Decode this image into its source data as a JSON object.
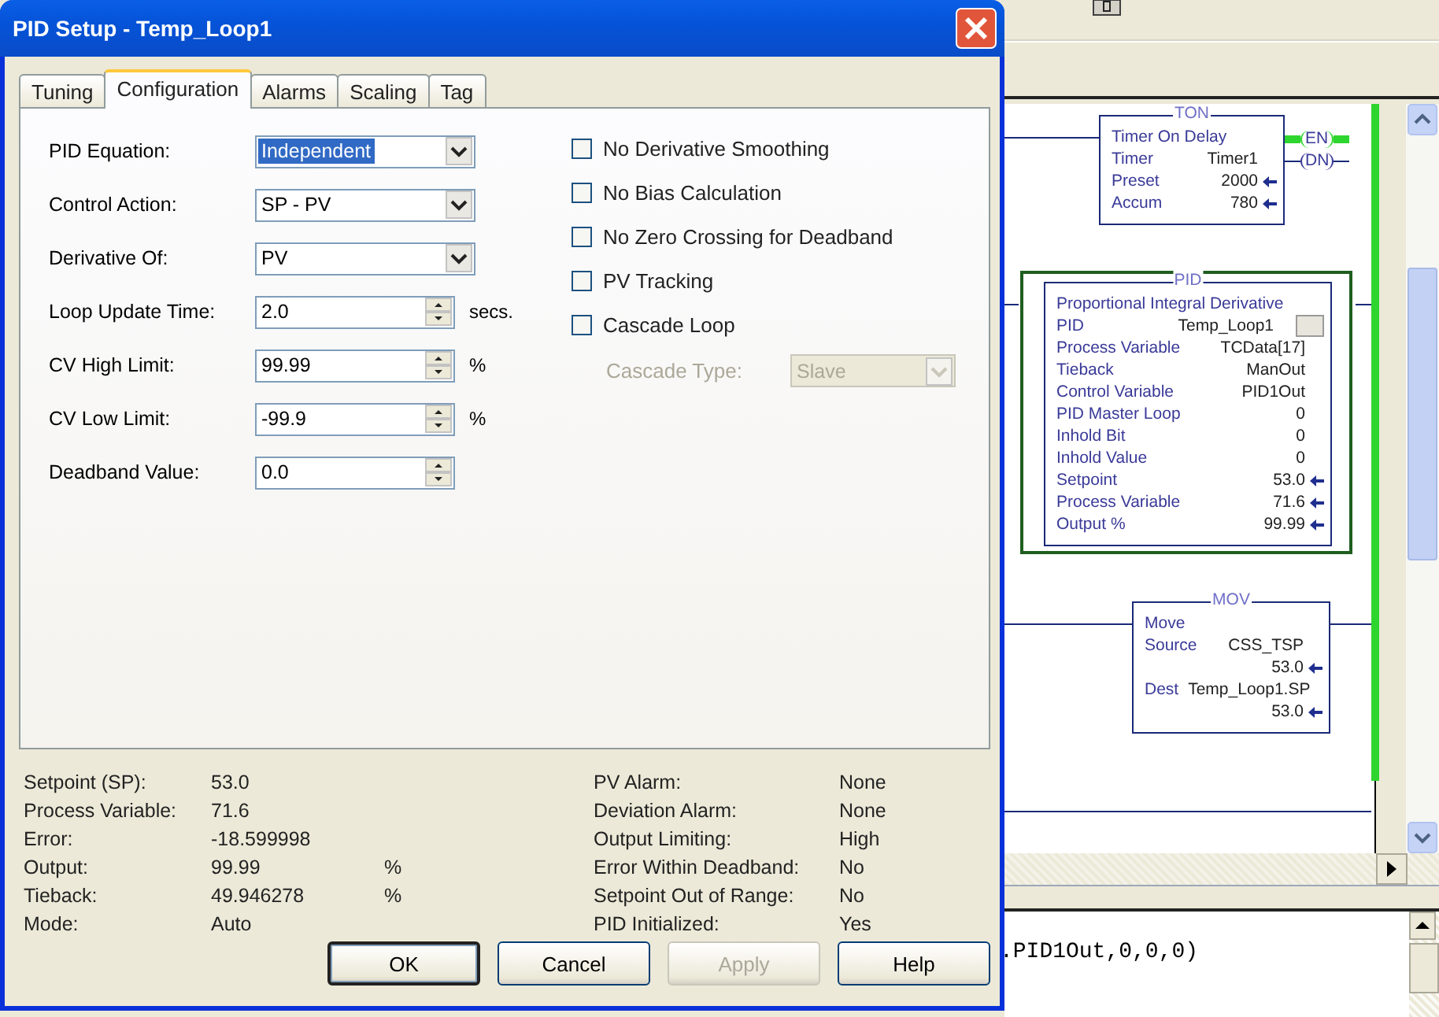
{
  "dialog": {
    "title": "PID Setup - Temp_Loop1",
    "tabs": [
      {
        "label": "Tuning",
        "selected": false
      },
      {
        "label": "Configuration",
        "selected": true
      },
      {
        "label": "Alarms",
        "selected": false
      },
      {
        "label": "Scaling",
        "selected": false
      },
      {
        "label": "Tag",
        "selected": false
      }
    ],
    "fields": [
      {
        "kind": "combo",
        "label": "PID Equation:",
        "value": "Independent",
        "highlighted": true
      },
      {
        "kind": "combo",
        "label": "Control Action:",
        "value": "SP - PV",
        "highlighted": false
      },
      {
        "kind": "combo",
        "label": "Derivative Of:",
        "value": "PV",
        "highlighted": false
      },
      {
        "kind": "spin",
        "label": "Loop Update Time:",
        "value": "2.0",
        "unit": "secs."
      },
      {
        "kind": "spin",
        "label": "CV High Limit:",
        "value": "99.99",
        "unit": "%"
      },
      {
        "kind": "spin",
        "label": "CV Low Limit:",
        "value": "-99.9",
        "unit": "%"
      },
      {
        "kind": "spin",
        "label": "Deadband Value:",
        "value": "0.0"
      }
    ],
    "options": [
      {
        "label": "No Derivative Smoothing",
        "checked": false
      },
      {
        "label": "No Bias Calculation",
        "checked": false
      },
      {
        "label": "No Zero Crossing for Deadband",
        "checked": false
      },
      {
        "label": "PV Tracking",
        "checked": false
      },
      {
        "label": "Cascade Loop",
        "checked": false
      }
    ],
    "cascade_type": {
      "label": "Cascade Type:",
      "value": "Slave",
      "disabled": true
    },
    "status_left": [
      {
        "label": "Setpoint (SP):",
        "value": "53.0"
      },
      {
        "label": "Process Variable:",
        "value": "71.6"
      },
      {
        "label": "Error:",
        "value": "-18.599998"
      },
      {
        "label": "Output:",
        "value": "99.99",
        "unit": "%"
      },
      {
        "label": "Tieback:",
        "value": "49.946278",
        "unit": "%"
      },
      {
        "label": "Mode:",
        "value": "Auto"
      }
    ],
    "status_right": [
      {
        "label": "PV Alarm:",
        "value": "None"
      },
      {
        "label": "Deviation Alarm:",
        "value": "None"
      },
      {
        "label": "Output Limiting:",
        "value": "High"
      },
      {
        "label": "Error Within Deadband:",
        "value": "No"
      },
      {
        "label": "Setpoint Out of Range:",
        "value": "No"
      },
      {
        "label": "PID Initialized:",
        "value": "Yes"
      }
    ],
    "buttons": [
      {
        "label": "OK",
        "default": true,
        "disabled": false
      },
      {
        "label": "Cancel",
        "default": false,
        "disabled": false
      },
      {
        "label": "Apply",
        "default": false,
        "disabled": true
      },
      {
        "label": "Help",
        "default": false,
        "disabled": false
      }
    ]
  },
  "ladder": {
    "blocks": [
      {
        "type": "TON",
        "description": "Timer On Delay",
        "rows": [
          {
            "label": "Timer",
            "value": "Timer1",
            "arrow": false
          },
          {
            "label": "Preset",
            "value": "2000",
            "arrow": true
          },
          {
            "label": "Accum",
            "value": "780",
            "arrow": true
          }
        ],
        "coils": [
          {
            "label": "EN",
            "energized": true
          },
          {
            "label": "DN",
            "energized": false
          }
        ]
      },
      {
        "type": "PID",
        "description": "Proportional Integral Derivative",
        "rows": [
          {
            "label": "PID",
            "value": "Temp_Loop1",
            "arrow": false
          },
          {
            "label": "Process Variable",
            "value": "TCData[17]",
            "arrow": false
          },
          {
            "label": "Tieback",
            "value": "ManOut",
            "arrow": false
          },
          {
            "label": "Control Variable",
            "value": "PID1Out",
            "arrow": false
          },
          {
            "label": "PID Master Loop",
            "value": "0",
            "arrow": false
          },
          {
            "label": "Inhold Bit",
            "value": "0",
            "arrow": false
          },
          {
            "label": "Inhold Value",
            "value": "0",
            "arrow": false
          },
          {
            "label": "Setpoint",
            "value": "53.0",
            "arrow": true
          },
          {
            "label": "Process Variable",
            "value": "71.6",
            "arrow": true
          },
          {
            "label": "Output %",
            "value": "99.99",
            "arrow": true
          }
        ]
      },
      {
        "type": "MOV",
        "description": "Move",
        "rows": [
          {
            "label": "Source",
            "value": "CSS_TSP",
            "arrow": false
          },
          {
            "value": "53.0",
            "arrow": true
          },
          {
            "label": "Dest",
            "value": "Temp_Loop1.SP",
            "arrow": false
          },
          {
            "value": "53.0",
            "arrow": true
          }
        ]
      }
    ]
  },
  "output_pane": {
    "text": ".PID1Out,0,0,0)"
  }
}
